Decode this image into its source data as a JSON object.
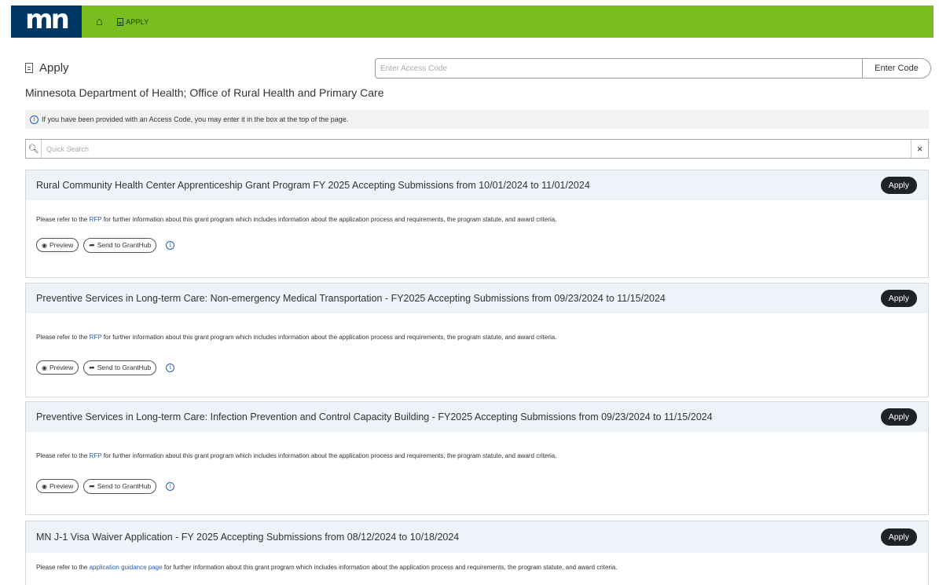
{
  "topbar": {
    "logo_text": "mn",
    "home_icon": "home-icon",
    "apply_label": "APPLY",
    "bar_color": "#78be20",
    "logo_color": "#003865"
  },
  "header": {
    "title": "Apply",
    "access_placeholder": "Enter Access Code",
    "access_button": "Enter Code",
    "department": "Minnesota Department of Health; Office of Rural Health and Primary Care"
  },
  "info": {
    "text": "If you have been provided with an Access Code, you may enter it in the box at the top of the page."
  },
  "search": {
    "placeholder": "Quick Search",
    "clear_label": "×"
  },
  "common": {
    "apply_label": "Apply",
    "preview_label": "Preview",
    "send_label": "Send to GrantHub",
    "desc_prefix": "Please refer to the",
    "desc_suffix": "for further information about this grant program which includes information about the application process and requirements, the program statute, and award criteria."
  },
  "cards": [
    {
      "title": "Rural Community Health Center Apprenticeship Grant Program FY 2025 Accepting Submissions from 10/01/2024 to 11/01/2024",
      "link_text": "RFP"
    },
    {
      "title": "Preventive Services in Long-term Care: Non-emergency Medical Transportation - FY2025 Accepting Submissions from 09/23/2024 to 11/15/2024",
      "link_text": "RFP"
    },
    {
      "title": "Preventive Services in Long-term Care: Infection Prevention and Control Capacity Building - FY2025 Accepting Submissions from 09/23/2024 to 11/15/2024",
      "link_text": "RFP"
    },
    {
      "title": "MN J-1 Visa Waiver Application - FY 2025 Accepting Submissions from 08/12/2024 to 10/18/2024",
      "link_text": "application guidance page"
    }
  ]
}
